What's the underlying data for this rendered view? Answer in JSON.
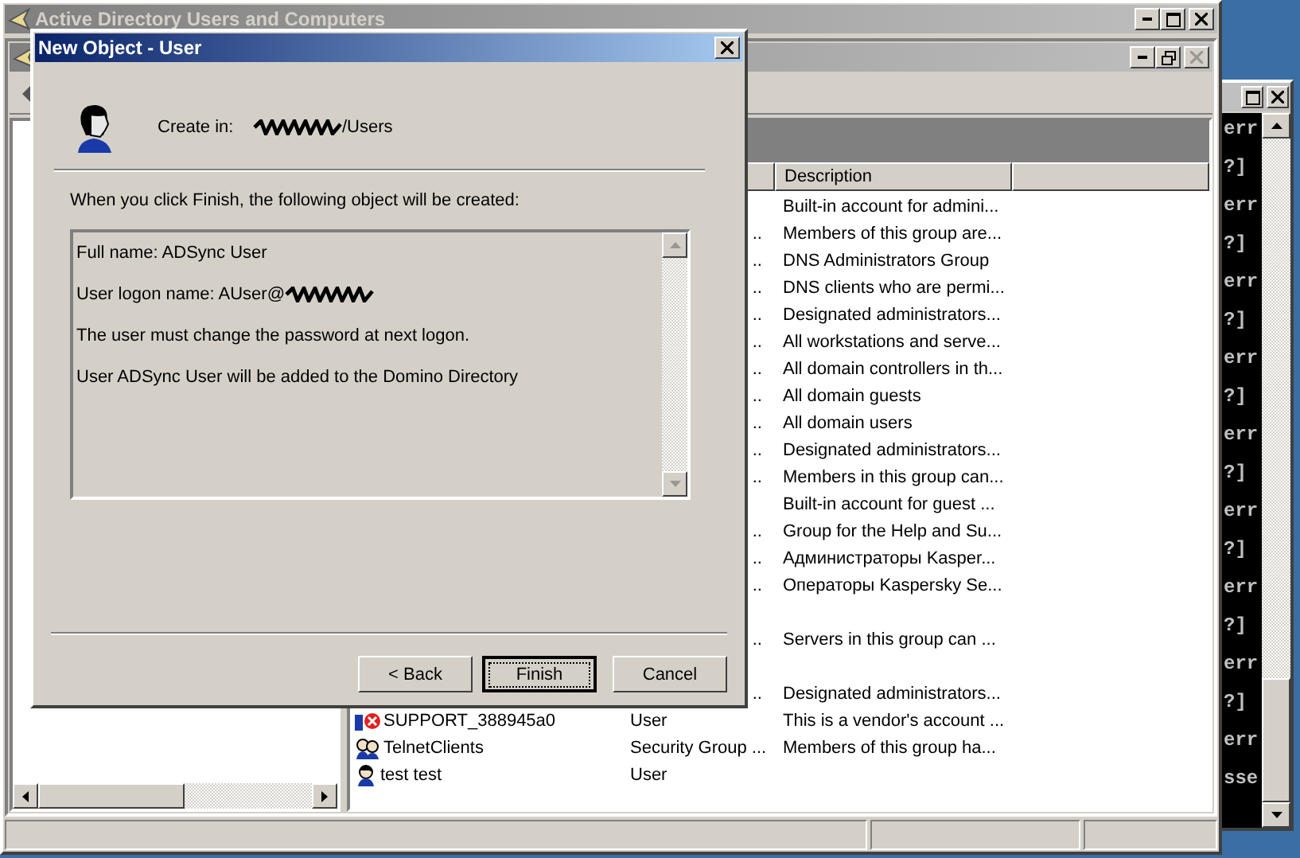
{
  "main_window": {
    "title": "Active Directory Users and Computers"
  },
  "list": {
    "columns": [
      {
        "label": "Description"
      }
    ],
    "rows": [
      {
        "kind": "covered",
        "type": "",
        "description": "Built-in account for admini..."
      },
      {
        "kind": "covered",
        "type": "..",
        "description": "Members of this group are..."
      },
      {
        "kind": "covered",
        "type": "..",
        "description": "DNS Administrators Group"
      },
      {
        "kind": "covered",
        "type": "..",
        "description": "DNS clients who are permi..."
      },
      {
        "kind": "covered",
        "type": "..",
        "description": "Designated administrators..."
      },
      {
        "kind": "covered",
        "type": "..",
        "description": "All workstations and serve..."
      },
      {
        "kind": "covered",
        "type": "..",
        "description": "All domain controllers in th..."
      },
      {
        "kind": "covered",
        "type": "..",
        "description": "All domain guests"
      },
      {
        "kind": "covered",
        "type": "..",
        "description": "All domain users"
      },
      {
        "kind": "covered",
        "type": "..",
        "description": "Designated administrators..."
      },
      {
        "kind": "covered",
        "type": "..",
        "description": "Members in this group can..."
      },
      {
        "kind": "covered",
        "type": "",
        "description": "Built-in account for guest ..."
      },
      {
        "kind": "covered",
        "type": "..",
        "description": "Group for the Help and Su..."
      },
      {
        "kind": "covered",
        "type": "..",
        "description": "Администраторы Kasper..."
      },
      {
        "kind": "covered",
        "type": "..",
        "description": "Операторы Kaspersky Se..."
      },
      {
        "kind": "blank"
      },
      {
        "kind": "covered",
        "type": "..",
        "description": "Servers in this group can ..."
      },
      {
        "kind": "blank"
      },
      {
        "kind": "covered",
        "type": "..",
        "description": "Designated administrators..."
      },
      {
        "kind": "disabled-user",
        "name": "SUPPORT_388945a0",
        "type": "User",
        "description": "This is a vendor's account ..."
      },
      {
        "kind": "group",
        "name": "TelnetClients",
        "type": "Security Group ...",
        "description": "Members of this group ha..."
      },
      {
        "kind": "user",
        "name": "test test",
        "type": "User"
      }
    ]
  },
  "dialog": {
    "title": "New Object - User",
    "create_in_label": "Create in:",
    "create_in_redacted": true,
    "create_in_value": "/Users",
    "intro": "When you click Finish, the following object will be created:",
    "summary": [
      {
        "text": "Full name: ADSync User",
        "redacted": false
      },
      {
        "text": "User logon name: AUser@",
        "redacted": true
      },
      {
        "text": "The user must change the password at next logon.",
        "redacted": false
      },
      {
        "text": "User ADSync User will be added to the Domino Directory",
        "redacted": false
      }
    ],
    "buttons": [
      {
        "label": "< Back",
        "default": false
      },
      {
        "label": "Finish",
        "default": true
      },
      {
        "label": "Cancel",
        "default": false
      }
    ]
  },
  "console": {
    "lines": [
      "err",
      "?]",
      "err",
      "?]",
      "err",
      "?]",
      "err",
      "?]",
      "err",
      "?]",
      "err",
      "?]",
      "err",
      "?]",
      "err",
      "?]",
      "err",
      "sse"
    ]
  }
}
